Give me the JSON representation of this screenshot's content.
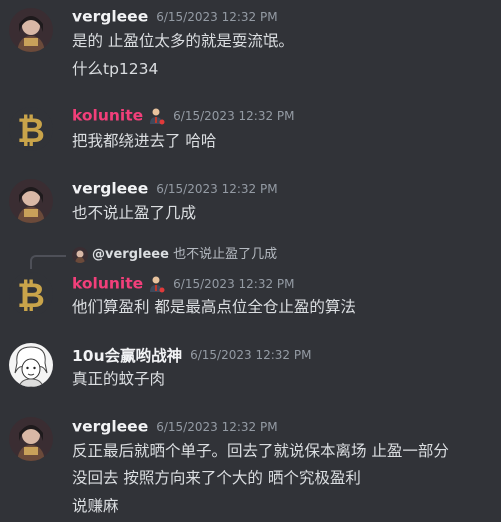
{
  "messages": [
    {
      "username": "vergleee",
      "timestamp": "6/15/2023 12:32 PM",
      "lines": [
        "是的 止盈位太多的就是耍流氓。",
        "什么tp1234"
      ]
    },
    {
      "username": "kolunite",
      "timestamp": "6/15/2023 12:32 PM",
      "lines": [
        "把我都绕进去了 哈哈"
      ]
    },
    {
      "username": "vergleee",
      "timestamp": "6/15/2023 12:32 PM",
      "lines": [
        "也不说止盈了几成"
      ]
    },
    {
      "reply": {
        "username": "@vergleee",
        "text": "也不说止盈了几成"
      },
      "username": "kolunite",
      "timestamp": "6/15/2023 12:32 PM",
      "lines": [
        "他们算盈利 都是最高点位全仓止盈的算法"
      ]
    },
    {
      "username": "10u会赢哟战神",
      "timestamp": "6/15/2023 12:32 PM",
      "lines": [
        "真正的蚊子肉"
      ]
    },
    {
      "username": "vergleee",
      "timestamp": "6/15/2023 12:32 PM",
      "lines": [
        "反正最后就晒个单子。回去了就说保本离场 止盈一部分",
        "没回去 按照方向来了个大的 晒个究极盈利",
        "说赚麻"
      ]
    }
  ],
  "colors": {
    "background": "#313338",
    "text": "#dbdee1",
    "timestamp": "#949ba4",
    "kolunite_name": "#f23f7a"
  }
}
